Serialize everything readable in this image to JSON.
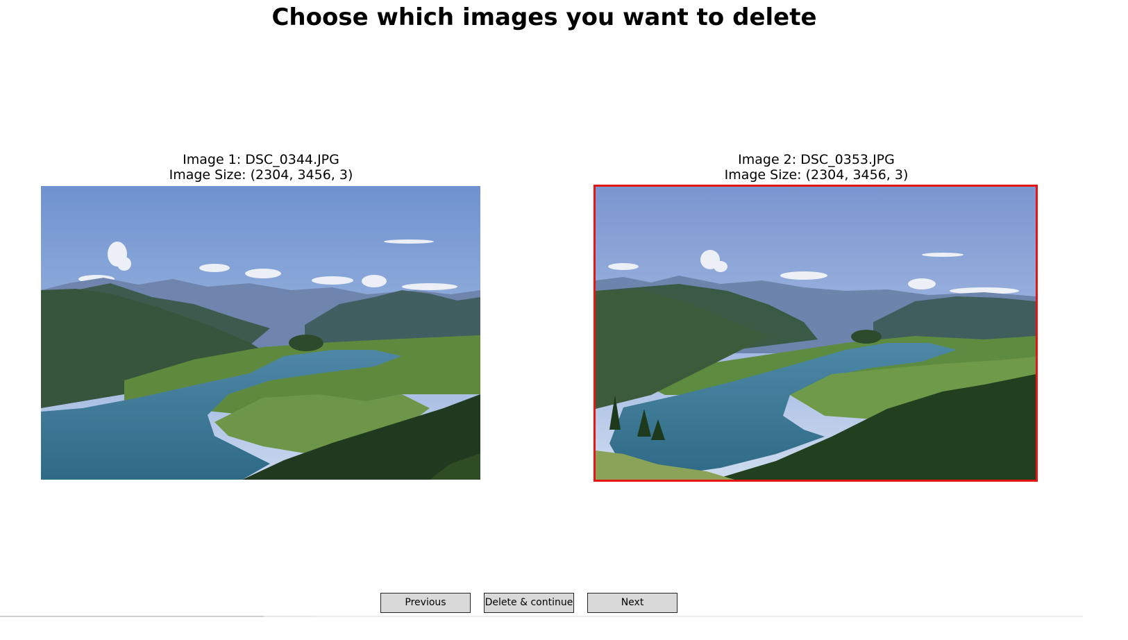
{
  "window": {
    "title": "Choose which images you want to delete"
  },
  "images": [
    {
      "caption_line1": "Image 1: DSC_0344.JPG",
      "caption_line2": "Image Size: (2304, 3456, 3)",
      "selected": false
    },
    {
      "caption_line1": "Image 2: DSC_0353.JPG",
      "caption_line2": "Image Size: (2304, 3456, 3)",
      "selected": true
    }
  ],
  "buttons": {
    "previous": "Previous",
    "delete_continue": "Delete & continue",
    "next": "Next"
  },
  "colors": {
    "selection_border": "#e81414",
    "button_bg": "#d9d9d9"
  }
}
